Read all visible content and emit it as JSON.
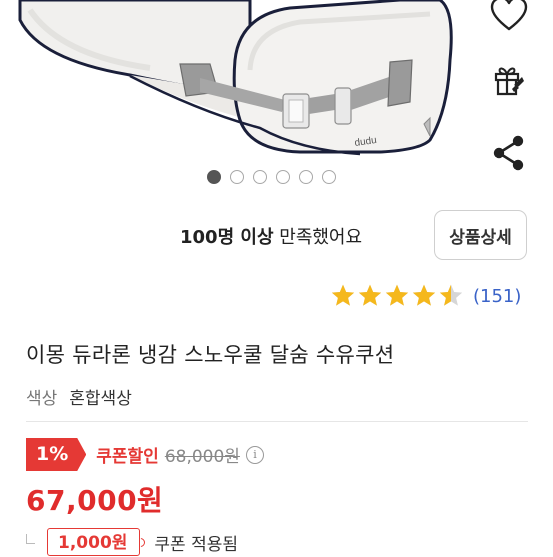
{
  "product_image": {
    "brand_mark": "dudu"
  },
  "icons": {
    "wishlist": "heart-icon",
    "gift": "gift-icon",
    "share": "share-icon",
    "info": "info-icon"
  },
  "carousel": {
    "total": 6,
    "active": 0
  },
  "satisfaction": {
    "bold": "100명 이상",
    "rest": " 만족했어요"
  },
  "detail_button": {
    "label": "상품상세"
  },
  "rating": {
    "value": 4.5,
    "max": 5,
    "count": "(151)"
  },
  "product": {
    "title": "이몽 듀라론 냉감 스노우쿨 달숨 수유쿠션",
    "option_label": "색상",
    "option_value": "혼합색상"
  },
  "pricing": {
    "discount_percent": "1%",
    "coupon_label": "쿠폰할인",
    "original_price": "68,000원",
    "final_price": "67,000원",
    "coupon_amount": "1,000원",
    "coupon_applied": "쿠폰 적용됨"
  },
  "colors": {
    "accent_red": "#e53935",
    "price_red": "#e02c2c",
    "star": "#f5b81c",
    "link_blue": "#3a63c8"
  }
}
